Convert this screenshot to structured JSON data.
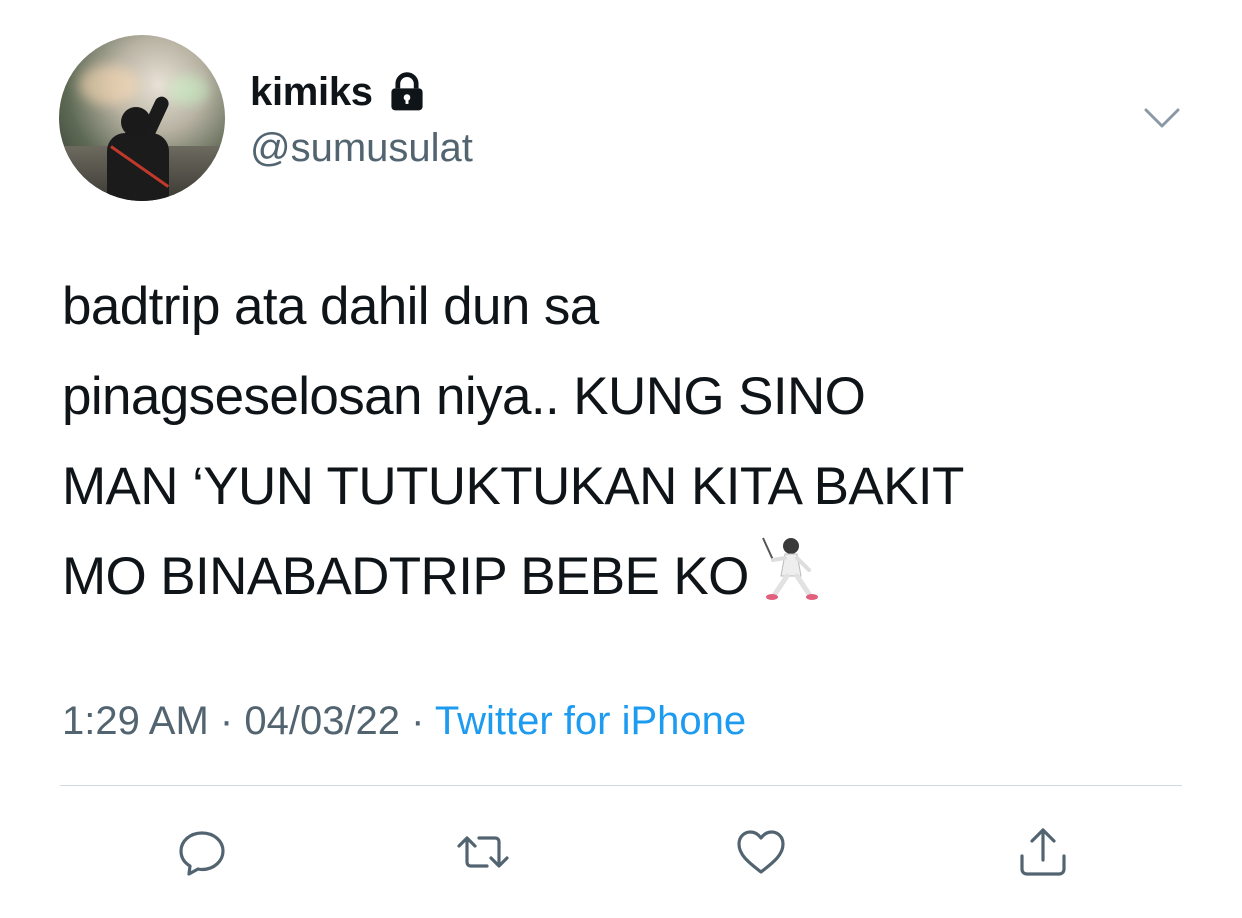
{
  "user": {
    "display_name": "kimiks",
    "handle": "@sumusulat",
    "protected_icon": "lock-icon",
    "avatar_icon": "profile-photo"
  },
  "tweet": {
    "text_lines": [
      "badtrip ata dahil dun sa",
      "pinagseselosan niya.. KUNG SINO",
      "MAN ‘YUN TUTUKTUKAN KITA BAKIT",
      "MO BINABADTRIP BEBE KO"
    ],
    "emoji": "fencer-emoji",
    "time": "1:29 AM",
    "separator": "·",
    "date": "04/03/22",
    "source": "Twitter for iPhone"
  },
  "actions": {
    "reply": "reply-icon",
    "retweet": "retweet-icon",
    "like": "heart-icon",
    "share": "share-icon"
  },
  "colors": {
    "text": "#0f1419",
    "secondary": "#536471",
    "link": "#1d9bf0",
    "divider": "#cfd9de"
  }
}
